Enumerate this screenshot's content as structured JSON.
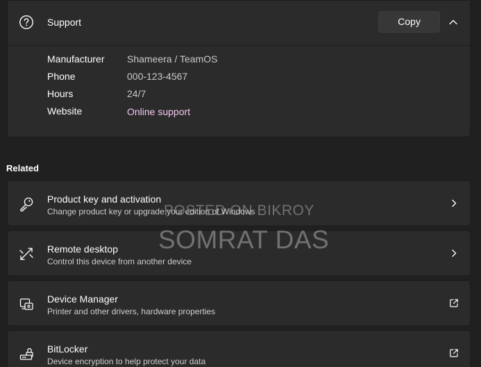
{
  "support": {
    "title": "Support",
    "copy_label": "Copy",
    "icon": "help-circle-icon",
    "collapse_icon": "chevron-up-icon",
    "details": [
      {
        "label": "Manufacturer",
        "value": "Shameera / TeamOS"
      },
      {
        "label": "Phone",
        "value": "000-123-4567"
      },
      {
        "label": "Hours",
        "value": "24/7"
      },
      {
        "label": "Website",
        "value": "Online support"
      }
    ]
  },
  "related": {
    "heading": "Related",
    "items": [
      {
        "title": "Product key and activation",
        "description": "Change product key or upgrade your edition of Windows",
        "icon": "key-icon",
        "action_icon": "chevron-right-icon"
      },
      {
        "title": "Remote desktop",
        "description": "Control this device from another device",
        "icon": "remote-desktop-icon",
        "action_icon": "chevron-right-icon"
      },
      {
        "title": "Device Manager",
        "description": "Printer and other drivers, hardware properties",
        "icon": "device-manager-icon",
        "action_icon": "open-external-icon"
      },
      {
        "title": "BitLocker",
        "description": "Device encryption to help protect your data",
        "icon": "bitlocker-icon",
        "action_icon": "open-external-icon"
      }
    ]
  },
  "watermark": {
    "line1": "POSTED ON BIKROY",
    "line2": "SOMRAT DAS"
  },
  "colors": {
    "background": "#202020",
    "card": "#2b2b2b",
    "link": "#f2c8f3"
  }
}
